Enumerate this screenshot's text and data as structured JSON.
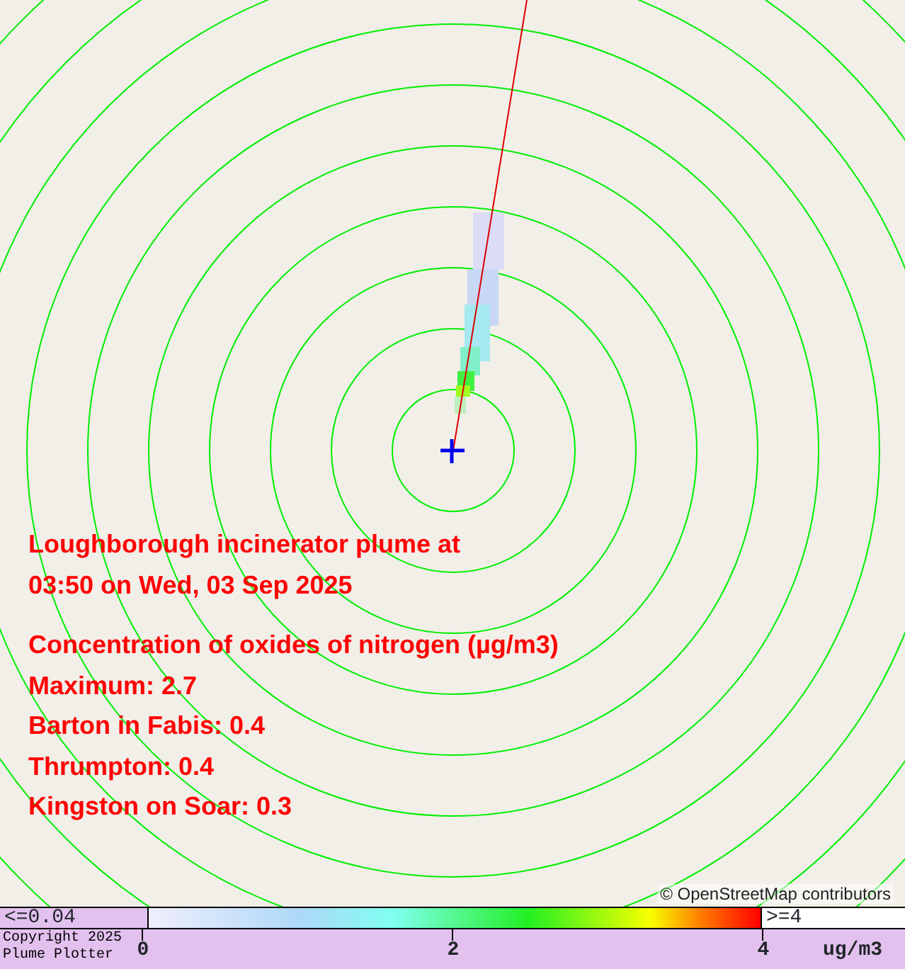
{
  "map": {
    "attribution": "© OpenStreetMap contributors"
  },
  "overlay": {
    "title_lines": [
      "Loughborough incinerator plume at",
      "03:50 on Wed, 03 Sep 2025"
    ],
    "pollutant": "Concentration of oxides of nitrogen (µg/m3)",
    "readings": [
      "Maximum: 2.7",
      "Barton in Fabis: 0.4",
      "Thrumpton: 0.4",
      "Kingston on Soar: 0.3"
    ]
  },
  "legend": {
    "min_label": "<=0.04",
    "max_label": ">=4",
    "ticks": [
      "0",
      "2",
      "4"
    ],
    "units": "ug/m3",
    "copyright": [
      "Copyright 2025",
      "Plume Plotter"
    ]
  }
}
